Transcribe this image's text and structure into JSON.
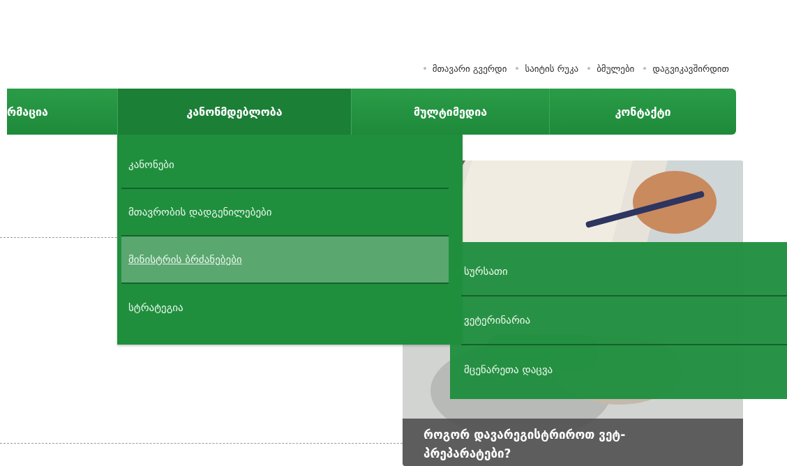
{
  "top_links": [
    "მთავარი გვერდი",
    "საიტის რუკა",
    "ბმულები",
    "დაგვიკავშირდით"
  ],
  "nav": [
    {
      "label": "რმაცია",
      "selected": false
    },
    {
      "label": "კანონმდებლობა",
      "selected": true
    },
    {
      "label": "მულტიმედია",
      "selected": false
    },
    {
      "label": "კონტაქტი",
      "selected": false
    }
  ],
  "dropdown": {
    "items": [
      {
        "label": "კანონები",
        "selected": false
      },
      {
        "label": "მთავრობის დადგენილებები",
        "selected": false
      },
      {
        "label": "მინისტრის ბრძანებები",
        "selected": true
      },
      {
        "label": "სტრატეგია",
        "selected": false
      }
    ]
  },
  "submenu": {
    "items": [
      {
        "label": "სურსათი",
        "selected": false
      },
      {
        "label": "ვეტერინარია",
        "selected": false
      },
      {
        "label": "მცენარეთა დაცვა",
        "selected": false
      }
    ]
  },
  "feature": {
    "caption": "როგორ დავარეგისტრიროთ ვეტ-პრეპარატები?"
  }
}
